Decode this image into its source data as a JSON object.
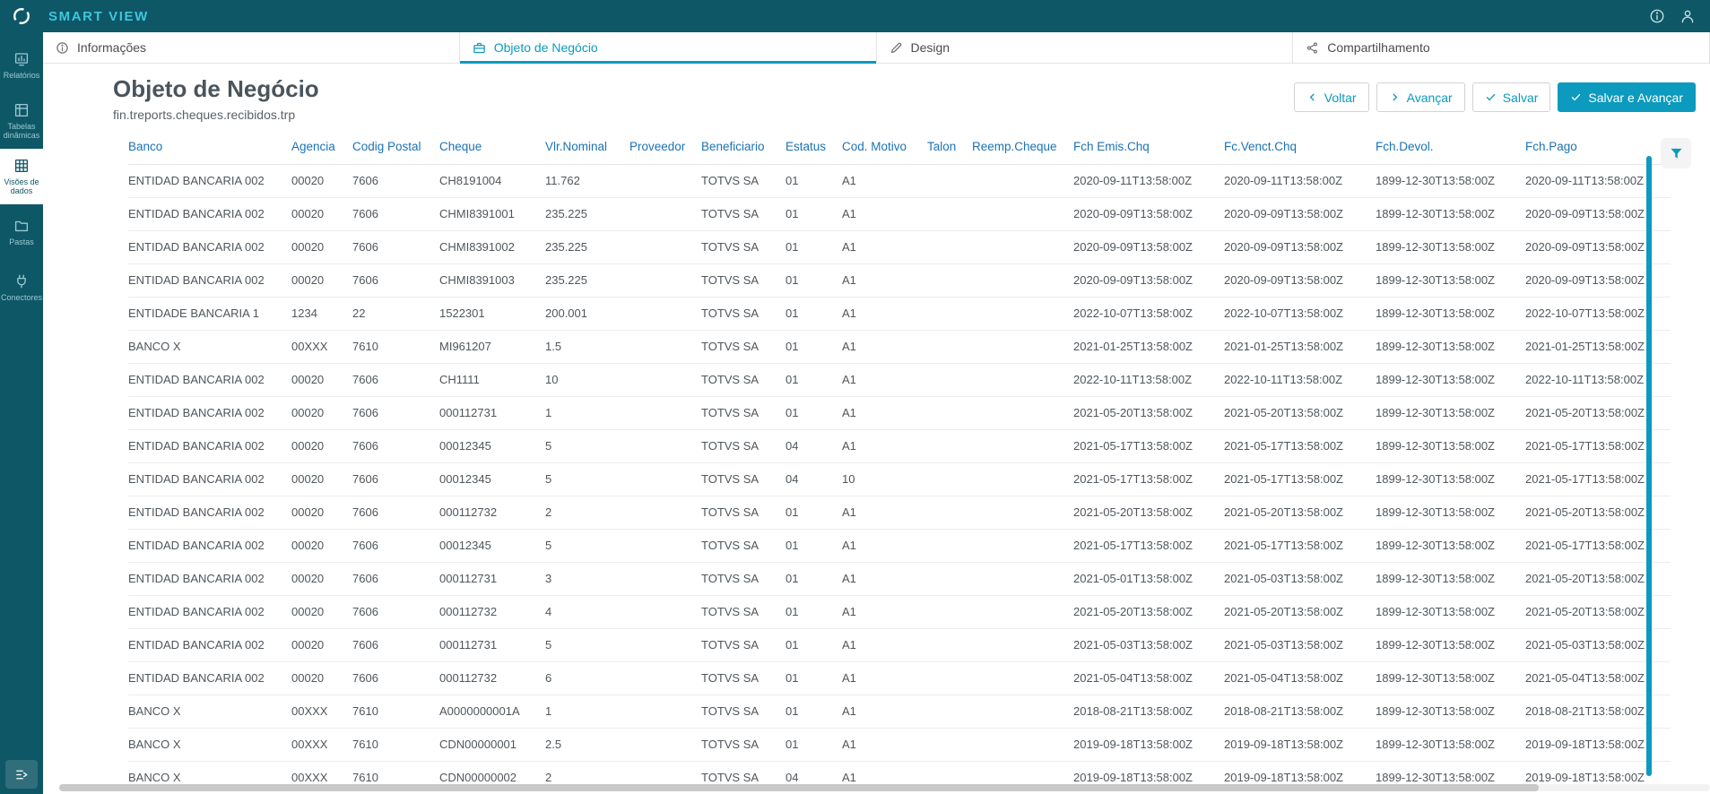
{
  "colors": {
    "topbar": "#0e5766",
    "brand": "#3fc6dc",
    "primary": "#0c9abe",
    "table_header": "#1b72b4",
    "scrollbar": "#0c9abe"
  },
  "topbar": {
    "brand": "SMART VIEW"
  },
  "icon_names": [
    "totvs-logo",
    "info",
    "user",
    "reports",
    "pivot-tables",
    "data-views",
    "folders",
    "connectors",
    "expand-menu",
    "briefcase",
    "design-pencil",
    "share",
    "chevron-left",
    "chevron-right",
    "check",
    "filter-funnel"
  ],
  "sidebar": {
    "items": [
      {
        "label": "Relatórios",
        "active": false
      },
      {
        "label": "Tabelas dinâmicas",
        "active": false
      },
      {
        "label": "Visões de dados",
        "active": true
      },
      {
        "label": "Pastas",
        "active": false
      },
      {
        "label": "Conectores",
        "active": false
      }
    ]
  },
  "tabs": [
    {
      "label": "Informações",
      "active": false
    },
    {
      "label": "Objeto de Negócio",
      "active": true
    },
    {
      "label": "Design",
      "active": false
    },
    {
      "label": "Compartilhamento",
      "active": false
    }
  ],
  "page": {
    "title": "Objeto de Negócio",
    "subtitle": "fin.treports.cheques.recibidos.trp"
  },
  "actions": {
    "back": "Voltar",
    "forward": "Avançar",
    "save": "Salvar",
    "save_forward": "Salvar e Avançar"
  },
  "table": {
    "columns": [
      "Banco",
      "Agencia",
      "Codig Postal",
      "Cheque",
      "Vlr.Nominal",
      "Proveedor",
      "Beneficiario",
      "Estatus",
      "Cod. Motivo",
      "Talon",
      "Reemp.Cheque",
      "Fch Emis.Chq",
      "Fc.Venct.Chq",
      "Fch.Devol.",
      "Fch.Pago"
    ],
    "rows": [
      [
        "ENTIDAD BANCARIA 002",
        "00020",
        "7606",
        "CH8191004",
        "11.762",
        "",
        "TOTVS SA",
        "01",
        "A1",
        "",
        "",
        "2020-09-11T13:58:00Z",
        "2020-09-11T13:58:00Z",
        "1899-12-30T13:58:00Z",
        "2020-09-11T13:58:00Z"
      ],
      [
        "ENTIDAD BANCARIA 002",
        "00020",
        "7606",
        "CHMI8391001",
        "235.225",
        "",
        "TOTVS SA",
        "01",
        "A1",
        "",
        "",
        "2020-09-09T13:58:00Z",
        "2020-09-09T13:58:00Z",
        "1899-12-30T13:58:00Z",
        "2020-09-09T13:58:00Z"
      ],
      [
        "ENTIDAD BANCARIA 002",
        "00020",
        "7606",
        "CHMI8391002",
        "235.225",
        "",
        "TOTVS SA",
        "01",
        "A1",
        "",
        "",
        "2020-09-09T13:58:00Z",
        "2020-09-09T13:58:00Z",
        "1899-12-30T13:58:00Z",
        "2020-09-09T13:58:00Z"
      ],
      [
        "ENTIDAD BANCARIA 002",
        "00020",
        "7606",
        "CHMI8391003",
        "235.225",
        "",
        "TOTVS SA",
        "01",
        "A1",
        "",
        "",
        "2020-09-09T13:58:00Z",
        "2020-09-09T13:58:00Z",
        "1899-12-30T13:58:00Z",
        "2020-09-09T13:58:00Z"
      ],
      [
        "ENTIDADE BANCARIA 1",
        "1234",
        "22",
        "1522301",
        "200.001",
        "",
        "TOTVS SA",
        "01",
        "A1",
        "",
        "",
        "2022-10-07T13:58:00Z",
        "2022-10-07T13:58:00Z",
        "1899-12-30T13:58:00Z",
        "2022-10-07T13:58:00Z"
      ],
      [
        "BANCO X",
        "00XXX",
        "7610",
        "MI961207",
        "1.5",
        "",
        "TOTVS SA",
        "01",
        "A1",
        "",
        "",
        "2021-01-25T13:58:00Z",
        "2021-01-25T13:58:00Z",
        "1899-12-30T13:58:00Z",
        "2021-01-25T13:58:00Z"
      ],
      [
        "ENTIDAD BANCARIA 002",
        "00020",
        "7606",
        "CH1111",
        "10",
        "",
        "TOTVS SA",
        "01",
        "A1",
        "",
        "",
        "2022-10-11T13:58:00Z",
        "2022-10-11T13:58:00Z",
        "1899-12-30T13:58:00Z",
        "2022-10-11T13:58:00Z"
      ],
      [
        "ENTIDAD BANCARIA 002",
        "00020",
        "7606",
        "000112731",
        "1",
        "",
        "TOTVS SA",
        "01",
        "A1",
        "",
        "",
        "2021-05-20T13:58:00Z",
        "2021-05-20T13:58:00Z",
        "1899-12-30T13:58:00Z",
        "2021-05-20T13:58:00Z"
      ],
      [
        "ENTIDAD BANCARIA 002",
        "00020",
        "7606",
        "00012345",
        "5",
        "",
        "TOTVS SA",
        "04",
        "A1",
        "",
        "",
        "2021-05-17T13:58:00Z",
        "2021-05-17T13:58:00Z",
        "1899-12-30T13:58:00Z",
        "2021-05-17T13:58:00Z"
      ],
      [
        "ENTIDAD BANCARIA 002",
        "00020",
        "7606",
        "00012345",
        "5",
        "",
        "TOTVS SA",
        "04",
        "10",
        "",
        "",
        "2021-05-17T13:58:00Z",
        "2021-05-17T13:58:00Z",
        "1899-12-30T13:58:00Z",
        "2021-05-17T13:58:00Z"
      ],
      [
        "ENTIDAD BANCARIA 002",
        "00020",
        "7606",
        "000112732",
        "2",
        "",
        "TOTVS SA",
        "01",
        "A1",
        "",
        "",
        "2021-05-20T13:58:00Z",
        "2021-05-20T13:58:00Z",
        "1899-12-30T13:58:00Z",
        "2021-05-20T13:58:00Z"
      ],
      [
        "ENTIDAD BANCARIA 002",
        "00020",
        "7606",
        "00012345",
        "5",
        "",
        "TOTVS SA",
        "01",
        "A1",
        "",
        "",
        "2021-05-17T13:58:00Z",
        "2021-05-17T13:58:00Z",
        "1899-12-30T13:58:00Z",
        "2021-05-17T13:58:00Z"
      ],
      [
        "ENTIDAD BANCARIA 002",
        "00020",
        "7606",
        "000112731",
        "3",
        "",
        "TOTVS SA",
        "01",
        "A1",
        "",
        "",
        "2021-05-01T13:58:00Z",
        "2021-05-03T13:58:00Z",
        "1899-12-30T13:58:00Z",
        "2021-05-20T13:58:00Z"
      ],
      [
        "ENTIDAD BANCARIA 002",
        "00020",
        "7606",
        "000112732",
        "4",
        "",
        "TOTVS SA",
        "01",
        "A1",
        "",
        "",
        "2021-05-20T13:58:00Z",
        "2021-05-20T13:58:00Z",
        "1899-12-30T13:58:00Z",
        "2021-05-20T13:58:00Z"
      ],
      [
        "ENTIDAD BANCARIA 002",
        "00020",
        "7606",
        "000112731",
        "5",
        "",
        "TOTVS SA",
        "01",
        "A1",
        "",
        "",
        "2021-05-03T13:58:00Z",
        "2021-05-03T13:58:00Z",
        "1899-12-30T13:58:00Z",
        "2021-05-03T13:58:00Z"
      ],
      [
        "ENTIDAD BANCARIA 002",
        "00020",
        "7606",
        "000112732",
        "6",
        "",
        "TOTVS SA",
        "01",
        "A1",
        "",
        "",
        "2021-05-04T13:58:00Z",
        "2021-05-04T13:58:00Z",
        "1899-12-30T13:58:00Z",
        "2021-05-04T13:58:00Z"
      ],
      [
        "BANCO X",
        "00XXX",
        "7610",
        "A0000000001A",
        "1",
        "",
        "TOTVS SA",
        "01",
        "A1",
        "",
        "",
        "2018-08-21T13:58:00Z",
        "2018-08-21T13:58:00Z",
        "1899-12-30T13:58:00Z",
        "2018-08-21T13:58:00Z"
      ],
      [
        "BANCO X",
        "00XXX",
        "7610",
        "CDN00000001",
        "2.5",
        "",
        "TOTVS SA",
        "01",
        "A1",
        "",
        "",
        "2019-09-18T13:58:00Z",
        "2019-09-18T13:58:00Z",
        "1899-12-30T13:58:00Z",
        "2019-09-18T13:58:00Z"
      ],
      [
        "BANCO X",
        "00XXX",
        "7610",
        "CDN00000002",
        "2",
        "",
        "TOTVS SA",
        "04",
        "A1",
        "",
        "",
        "2019-09-18T13:58:00Z",
        "2019-09-18T13:58:00Z",
        "1899-12-30T13:58:00Z",
        "2019-09-18T13:58:00Z"
      ]
    ]
  }
}
